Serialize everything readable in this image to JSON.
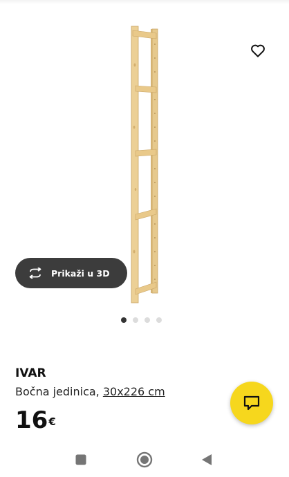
{
  "product": {
    "name": "IVAR",
    "description_prefix": "Bočna jedinica, ",
    "dimensions": "30x226 cm",
    "price": "16",
    "currency": "€"
  },
  "gallery": {
    "view_3d_label": "Prikaži u 3D",
    "active_index": 0,
    "total": 4
  },
  "icons": {
    "favorite": "heart-outline-icon",
    "view_3d": "rotate-3d-icon",
    "chat": "chat-bubble-icon",
    "nav_recents": "square-icon",
    "nav_home": "circle-home-icon",
    "nav_back": "triangle-back-icon"
  },
  "colors": {
    "fab": "#f6d71d",
    "pill": "#3c3c3c",
    "wood": "#e9c98a"
  }
}
